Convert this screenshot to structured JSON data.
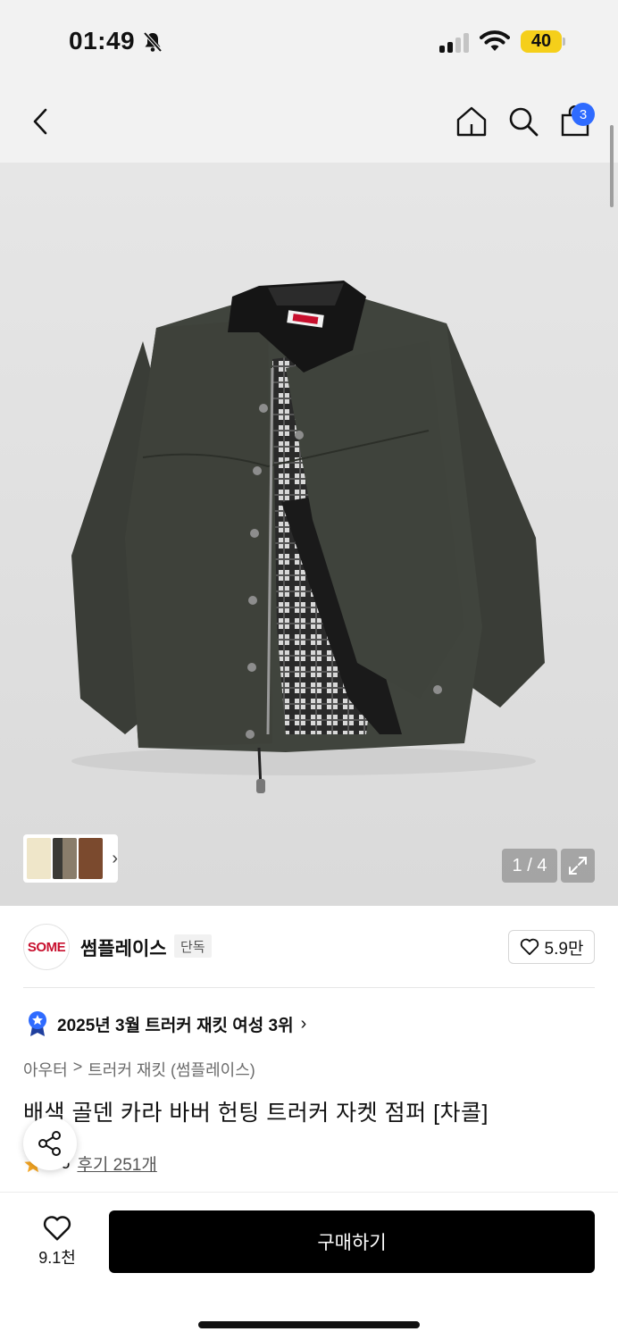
{
  "status_bar": {
    "time": "01:49",
    "battery": "40"
  },
  "nav": {
    "cart_count": "3"
  },
  "gallery": {
    "counter": "1 / 4"
  },
  "brand": {
    "logo_text": "SOME",
    "name": "썸플레이스",
    "badge": "단독",
    "likes": "5.9만"
  },
  "ranking": {
    "text": "2025년 3월 트러커 재킷 여성 3위"
  },
  "breadcrumb": {
    "items": [
      "아우터",
      ">",
      "트러커 재킷 (썸플레이스)"
    ]
  },
  "product": {
    "title": "배색 골덴 카라 바버 헌팅 트러커 자켓 점퍼 [차콜]",
    "rating": "4.6",
    "reviews": "후기 251개"
  },
  "bottom_bar": {
    "wish_count": "9.1천",
    "buy_label": "구매하기"
  },
  "colors": {
    "accent_blue": "#2f6bff",
    "battery_yellow": "#f5cf1a",
    "jacket": "#3c3f39",
    "collar": "#141414",
    "star": "#f5a623"
  }
}
